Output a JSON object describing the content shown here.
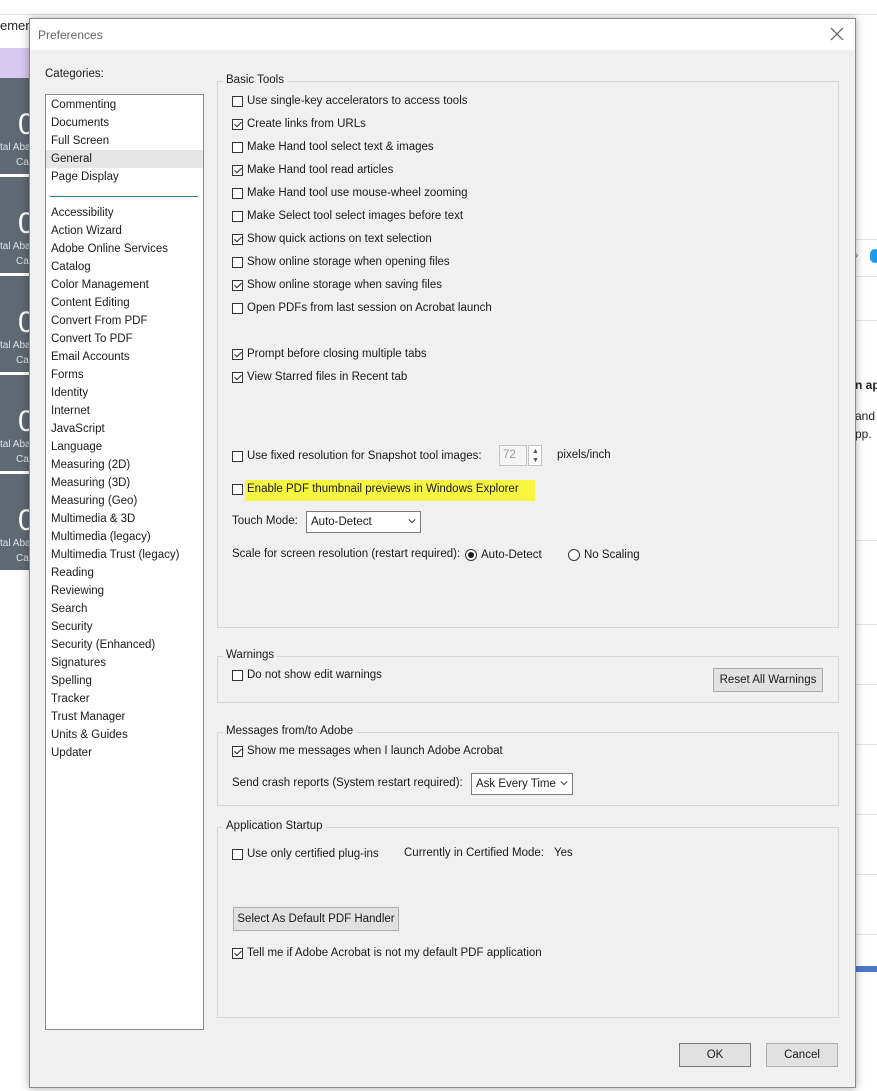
{
  "background": {
    "partial_menu_text": "ement",
    "tiles": [
      {
        "big": "0",
        "line1": "tal Aba",
        "line2": "Ca"
      },
      {
        "big": "0",
        "line1": "tal Aba",
        "line2": "Ca"
      },
      {
        "big": "0",
        "line1": "tal Aba",
        "line2": "Ca"
      },
      {
        "big": "0",
        "line1": "tal Aba",
        "line2": "Ca"
      },
      {
        "big": "0",
        "line1": "tal Aba",
        "line2": "Ca"
      }
    ],
    "right_text": [
      "n ap",
      "and",
      "pp."
    ]
  },
  "dialog": {
    "title": "Preferences",
    "categories_label": "Categories:",
    "categories_top": [
      "Commenting",
      "Documents",
      "Full Screen",
      "General",
      "Page Display"
    ],
    "categories_bottom": [
      "Accessibility",
      "Action Wizard",
      "Adobe Online Services",
      "Catalog",
      "Color Management",
      "Content Editing",
      "Convert From PDF",
      "Convert To PDF",
      "Email Accounts",
      "Forms",
      "Identity",
      "Internet",
      "JavaScript",
      "Language",
      "Measuring (2D)",
      "Measuring (3D)",
      "Measuring (Geo)",
      "Multimedia & 3D",
      "Multimedia (legacy)",
      "Multimedia Trust (legacy)",
      "Reading",
      "Reviewing",
      "Search",
      "Security",
      "Security (Enhanced)",
      "Signatures",
      "Spelling",
      "Tracker",
      "Trust Manager",
      "Units & Guides",
      "Updater"
    ],
    "selected_category": "General",
    "basic_tools": {
      "legend": "Basic Tools",
      "options": [
        {
          "label": "Use single-key accelerators to access tools",
          "checked": false
        },
        {
          "label": "Create links from URLs",
          "checked": true
        },
        {
          "label": "Make Hand tool select text & images",
          "checked": false
        },
        {
          "label": "Make Hand tool read articles",
          "checked": true
        },
        {
          "label": "Make Hand tool use mouse-wheel zooming",
          "checked": false
        },
        {
          "label": "Make Select tool select images before text",
          "checked": false
        },
        {
          "label": "Show quick actions on text selection",
          "checked": true
        },
        {
          "label": "Show online storage when opening files",
          "checked": false
        },
        {
          "label": "Show online storage when saving files",
          "checked": true
        },
        {
          "label": "Open PDFs from last session on Acrobat launch",
          "checked": false
        },
        {
          "label": "Prompt before closing multiple tabs",
          "checked": true
        },
        {
          "label": "View Starred files in Recent tab",
          "checked": true
        }
      ],
      "snapshot_label": "Use fixed resolution for Snapshot tool images:",
      "snapshot_checked": false,
      "snapshot_value": "72",
      "snapshot_unit": "pixels/inch",
      "thumbnail_label": "Enable PDF thumbnail previews in Windows Explorer",
      "thumbnail_checked": false,
      "highlight_color": "#f6f641",
      "touch_mode_label": "Touch Mode:",
      "touch_mode_value": "Auto-Detect",
      "scale_label": "Scale for screen resolution (restart required):",
      "scale_options": [
        {
          "label": "Auto-Detect",
          "selected": true
        },
        {
          "label": "No Scaling",
          "selected": false
        }
      ]
    },
    "warnings": {
      "legend": "Warnings",
      "option_label": "Do not show edit warnings",
      "option_checked": false,
      "reset_button": "Reset All Warnings"
    },
    "messages": {
      "legend": "Messages from/to Adobe",
      "show_messages_label": "Show me messages when I launch Adobe Acrobat",
      "show_messages_checked": true,
      "crash_label": "Send crash reports (System restart required):",
      "crash_value": "Ask Every Time"
    },
    "startup": {
      "legend": "Application Startup",
      "certified_label": "Use only certified plug-ins",
      "certified_checked": false,
      "certified_mode_label": "Currently in Certified Mode:",
      "certified_mode_value": "Yes",
      "default_handler_button": "Select As Default PDF Handler",
      "tell_me_label": "Tell me if Adobe Acrobat is not my default PDF application",
      "tell_me_checked": true
    },
    "ok_button": "OK",
    "cancel_button": "Cancel"
  }
}
